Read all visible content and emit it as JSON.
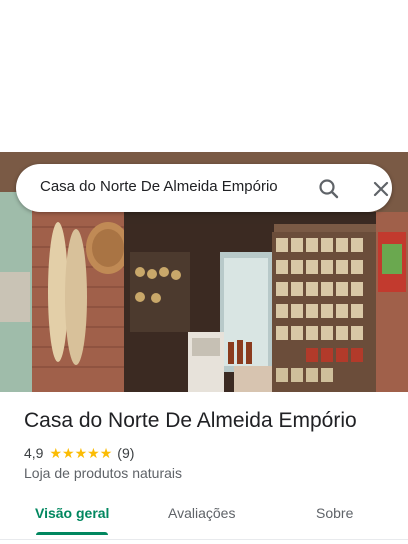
{
  "search": {
    "query": "Casa do Norte De Almeida Empório",
    "search_icon": "search-icon",
    "close_icon": "close-icon"
  },
  "place": {
    "name": "Casa do Norte De Almeida Empório",
    "rating": "4,9",
    "stars": 5,
    "review_count": "(9)",
    "category": "Loja de produtos naturais"
  },
  "tabs": [
    {
      "label": "Visão geral",
      "active": true
    },
    {
      "label": "Avaliações",
      "active": false
    },
    {
      "label": "Sobre",
      "active": false
    }
  ],
  "colors": {
    "accent": "#01875f",
    "star": "#fbbc04",
    "text_primary": "#202124",
    "text_secondary": "#5f6368"
  }
}
